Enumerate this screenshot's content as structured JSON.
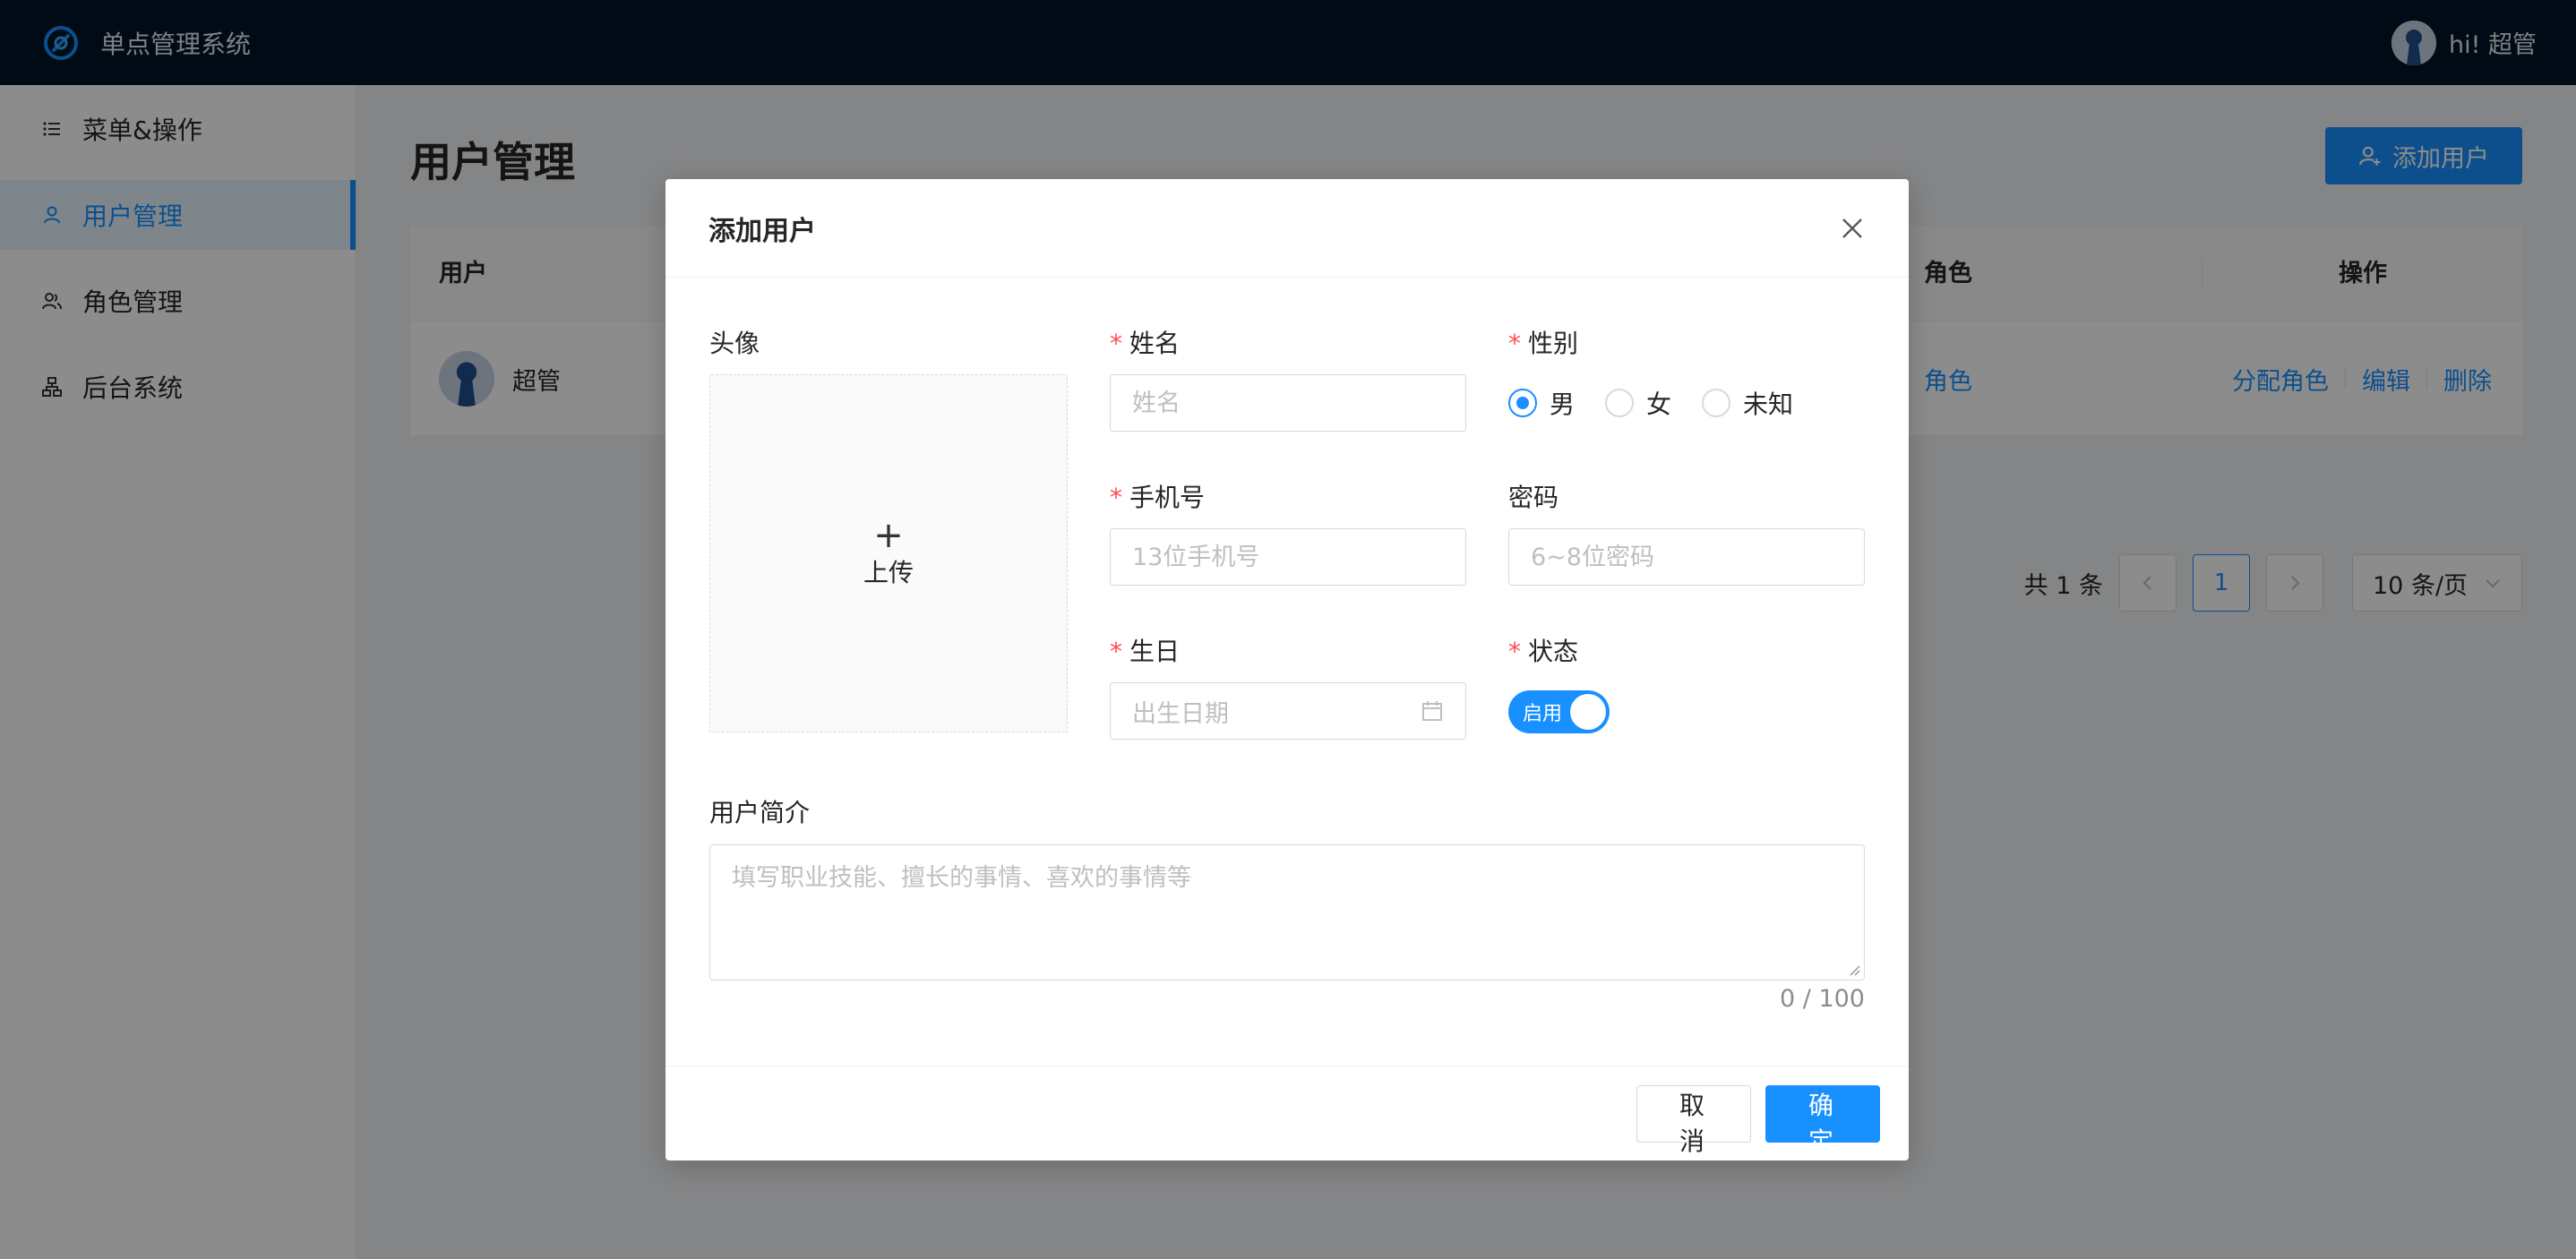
{
  "header": {
    "app_title": "单点管理系统",
    "greeting": "hi! 超管"
  },
  "sidebar": {
    "items": [
      {
        "label": "菜单&操作",
        "icon": "list-icon"
      },
      {
        "label": "用户管理",
        "icon": "user-icon",
        "active": true
      },
      {
        "label": "角色管理",
        "icon": "team-icon"
      },
      {
        "label": "后台系统",
        "icon": "cluster-icon"
      }
    ]
  },
  "main": {
    "page_title": "用户管理",
    "add_button": "添加用户",
    "table": {
      "columns": {
        "user": "用户",
        "role": "角色",
        "actions": "操作"
      },
      "rows": [
        {
          "name": "超管",
          "role": "角色",
          "actions": [
            "分配角色",
            "编辑",
            "删除"
          ]
        }
      ]
    },
    "pagination": {
      "total": "共 1 条",
      "current": "1",
      "page_size": "10 条/页"
    }
  },
  "modal": {
    "title": "添加用户",
    "avatar_label": "头像",
    "upload_plus": "+",
    "upload_text": "上传",
    "name_label": "姓名",
    "name_placeholder": "姓名",
    "gender_label": "性别",
    "gender_options": [
      "男",
      "女",
      "未知"
    ],
    "gender_selected": "男",
    "phone_label": "手机号",
    "phone_placeholder": "13位手机号",
    "password_label": "密码",
    "password_placeholder": "6~8位密码",
    "birthday_label": "生日",
    "birthday_placeholder": "出生日期",
    "status_label": "状态",
    "status_text": "启用",
    "bio_label": "用户简介",
    "bio_placeholder": "填写职业技能、擅长的事情、喜欢的事情等",
    "counter": "0 / 100",
    "cancel": "取 消",
    "ok": "确 定"
  },
  "colors": {
    "primary": "#1890ff",
    "header_bg": "#001529",
    "required": "#ff4d4f"
  }
}
